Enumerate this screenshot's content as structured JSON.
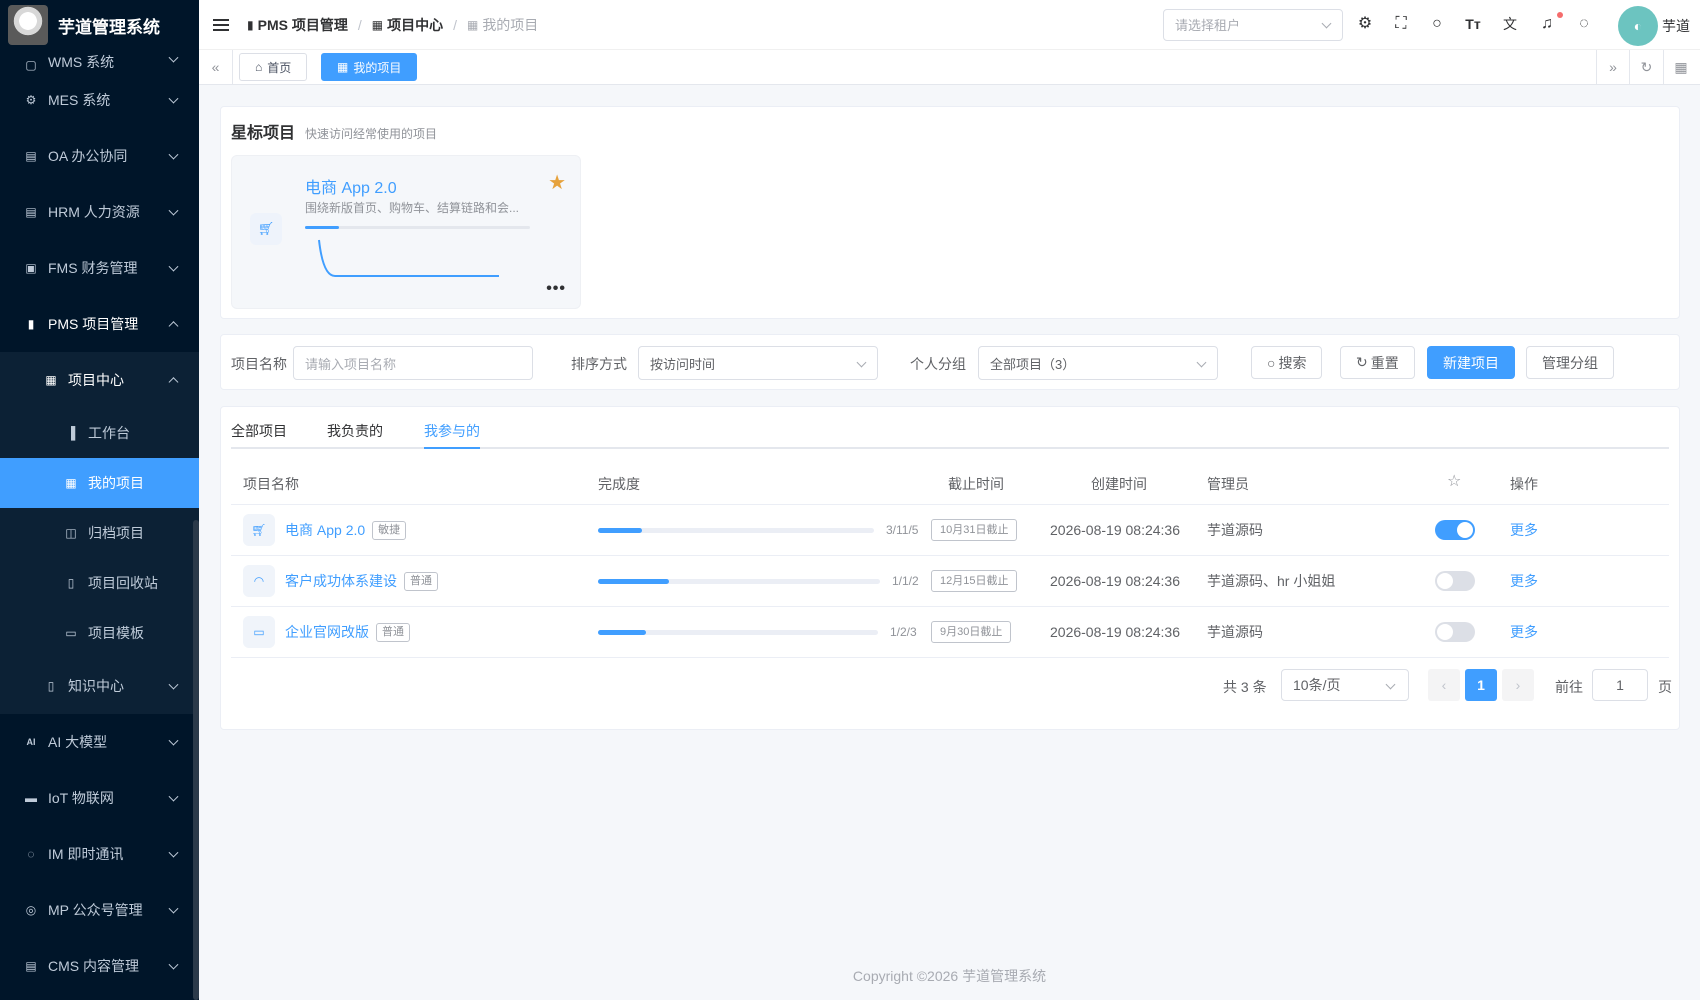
{
  "app": {
    "title": "芋道管理系统"
  },
  "sidebar": {
    "partial_item": "WMS 系统",
    "items_top": [
      {
        "label": "MES 系统",
        "icon": "gear-icon"
      },
      {
        "label": "OA 办公协同",
        "icon": "building-icon"
      },
      {
        "label": "HRM 人力资源",
        "icon": "building-icon"
      },
      {
        "label": "FMS 财务管理",
        "icon": "wallet-icon"
      },
      {
        "label": "PMS 项目管理",
        "icon": "chart-icon"
      }
    ],
    "project_center": "项目中心",
    "sub_items": [
      {
        "label": "工作台",
        "icon": "clipboard-icon"
      },
      {
        "label": "我的项目",
        "icon": "grid-icon"
      },
      {
        "label": "归档项目",
        "icon": "archive-icon"
      },
      {
        "label": "项目回收站",
        "icon": "trash-icon"
      },
      {
        "label": "项目模板",
        "icon": "template-icon"
      }
    ],
    "knowledge_center": "知识中心",
    "items_bottom": [
      {
        "label": "AI 大模型",
        "icon": "ai-icon"
      },
      {
        "label": "IoT 物联网",
        "icon": "iot-icon"
      },
      {
        "label": "IM 即时通讯",
        "icon": "chat-icon"
      },
      {
        "label": "MP 公众号管理",
        "icon": "compass-icon"
      },
      {
        "label": "CMS 内容管理",
        "icon": "document-icon"
      }
    ]
  },
  "header": {
    "breadcrumb": [
      "PMS 项目管理",
      "项目中心",
      "我的项目"
    ],
    "tenant_placeholder": "请选择租户",
    "user": "芋道"
  },
  "tags": {
    "home": "首页",
    "current": "我的项目"
  },
  "starred": {
    "title": "星标项目",
    "subtitle": "快速访问经常使用的项目",
    "project": {
      "name": "电商 App 2.0",
      "desc": "围绕新版首页、购物车、结算链路和会...",
      "progress": 0.15,
      "more": "•••"
    }
  },
  "filter": {
    "name_label": "项目名称",
    "name_placeholder": "请输入项目名称",
    "sort_label": "排序方式",
    "sort_value": "按访问时间",
    "group_label": "个人分组",
    "group_value": "全部项目（3）",
    "search": "搜索",
    "reset": "重置",
    "create": "新建项目",
    "manage_group": "管理分组"
  },
  "tabs": [
    "全部项目",
    "我负责的",
    "我参与的"
  ],
  "table": {
    "columns": [
      "项目名称",
      "完成度",
      "截止时间",
      "创建时间",
      "管理员",
      "操作"
    ],
    "rows": [
      {
        "name": "电商 App 2.0",
        "tag": "敏捷",
        "icon": "cart-icon",
        "progress": 0.16,
        "progress_text": "3/11/5",
        "due": "10月31日截止",
        "created": "2026-08-19 08:24:36",
        "admin": "芋道源码",
        "starred": true,
        "op": "更多"
      },
      {
        "name": "客户成功体系建设",
        "tag": "普通",
        "icon": "headset-icon",
        "progress": 0.25,
        "progress_text": "1/1/2",
        "due": "12月15日截止",
        "created": "2026-08-19 08:24:36",
        "admin": "芋道源码、hr 小姐姐",
        "starred": false,
        "op": "更多"
      },
      {
        "name": "企业官网改版",
        "tag": "普通",
        "icon": "monitor-icon",
        "progress": 0.17,
        "progress_text": "1/2/3",
        "due": "9月30日截止",
        "created": "2026-08-19 08:24:36",
        "admin": "芋道源码",
        "starred": false,
        "op": "更多"
      }
    ]
  },
  "pagination": {
    "total": "共 3 条",
    "page_size": "10条/页",
    "current": "1",
    "goto": "前往",
    "goto_value": "1",
    "unit": "页"
  },
  "footer": "Copyright ©2026 芋道管理系统"
}
